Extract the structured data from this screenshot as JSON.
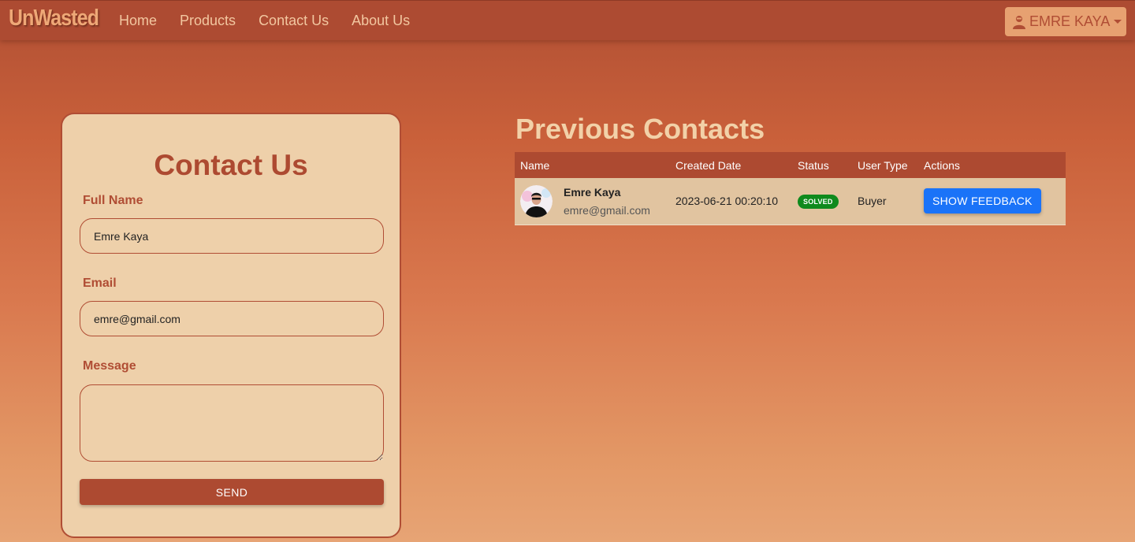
{
  "navbar": {
    "brand": "UnWasted",
    "links": [
      "Home",
      "Products",
      "Contact Us",
      "About Us"
    ],
    "user_label": "EMRE KAYA"
  },
  "contact_form": {
    "title": "Contact Us",
    "full_name_label": "Full Name",
    "full_name_value": "Emre Kaya",
    "email_label": "Email",
    "email_value": "emre@gmail.com",
    "message_label": "Message",
    "message_value": "",
    "send_label": "SEND"
  },
  "previous_contacts": {
    "title": "Previous Contacts",
    "columns": [
      "Name",
      "Created Date",
      "Status",
      "User Type",
      "Actions"
    ],
    "rows": [
      {
        "name": "Emre Kaya",
        "email": "emre@gmail.com",
        "created_date": "2023-06-21 00:20:10",
        "status": "SOLVED",
        "user_type": "Buyer",
        "action_label": "SHOW FEEDBACK"
      }
    ]
  },
  "colors": {
    "primary": "#ad4a31",
    "card_bg": "#eed0aa",
    "status_solved": "#0f8a1d",
    "action_button": "#1a73f8"
  },
  "icons": [
    "user-icon",
    "caret-down-icon"
  ]
}
